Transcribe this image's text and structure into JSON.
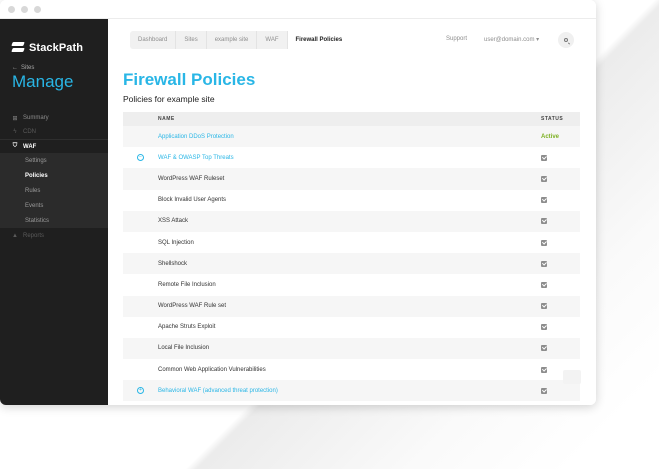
{
  "window": {
    "traffic_lights": [
      "close",
      "minimize",
      "zoom"
    ]
  },
  "sidebar": {
    "brand": "StackPath",
    "back_label": "Sites",
    "section_title": "Manage",
    "nav": [
      {
        "label": "Summary",
        "icon": "grid-icon"
      },
      {
        "label": "CDN",
        "icon": "bolt-icon"
      },
      {
        "label": "WAF",
        "icon": "shield-icon"
      }
    ],
    "waf_sub": [
      "Settings",
      "Policies",
      "Rules",
      "Events",
      "Statistics"
    ],
    "reports": {
      "label": "Reports",
      "icon": "chart-icon"
    }
  },
  "header": {
    "breadcrumb": [
      "Dashboard",
      "Sites",
      "example site",
      "WAF",
      "Firewall Policies"
    ],
    "support": "Support",
    "user": "user@domain.com",
    "user_caret": "▾"
  },
  "page": {
    "title": "Firewall Policies",
    "subtitle": "Policies for example site"
  },
  "table": {
    "columns": {
      "name": "NAME",
      "status": "STATUS"
    },
    "rows": [
      {
        "name": "Application DDoS Protection",
        "status": "Active",
        "link": true,
        "toggle": ""
      },
      {
        "name": "WAF & OWASP Top Threats",
        "status": "check",
        "link": true,
        "toggle": "−"
      },
      {
        "name": "WordPress WAF Ruleset",
        "status": "check",
        "link": false,
        "toggle": ""
      },
      {
        "name": "Block Invalid User Agents",
        "status": "check",
        "link": false,
        "toggle": ""
      },
      {
        "name": "XSS Attack",
        "status": "check",
        "link": false,
        "toggle": ""
      },
      {
        "name": "SQL Injection",
        "status": "check",
        "link": false,
        "toggle": ""
      },
      {
        "name": "Shellshock",
        "status": "check",
        "link": false,
        "toggle": ""
      },
      {
        "name": "Remote File Inclusion",
        "status": "check",
        "link": false,
        "toggle": ""
      },
      {
        "name": "WordPress WAF Rule set",
        "status": "check",
        "link": false,
        "toggle": ""
      },
      {
        "name": "Apache Struts Exploit",
        "status": "check",
        "link": false,
        "toggle": ""
      },
      {
        "name": "Local File Inclusion",
        "status": "check",
        "link": false,
        "toggle": ""
      },
      {
        "name": "Common Web Application Vulnerabilities",
        "status": "check",
        "link": false,
        "toggle": ""
      },
      {
        "name": "Behavioral WAF (advanced threat protection)",
        "status": "check",
        "link": true,
        "toggle": "+"
      }
    ]
  },
  "colors": {
    "accent": "#29b6e6",
    "active": "#7db122",
    "sidebar_bg": "#1f1f1f"
  }
}
